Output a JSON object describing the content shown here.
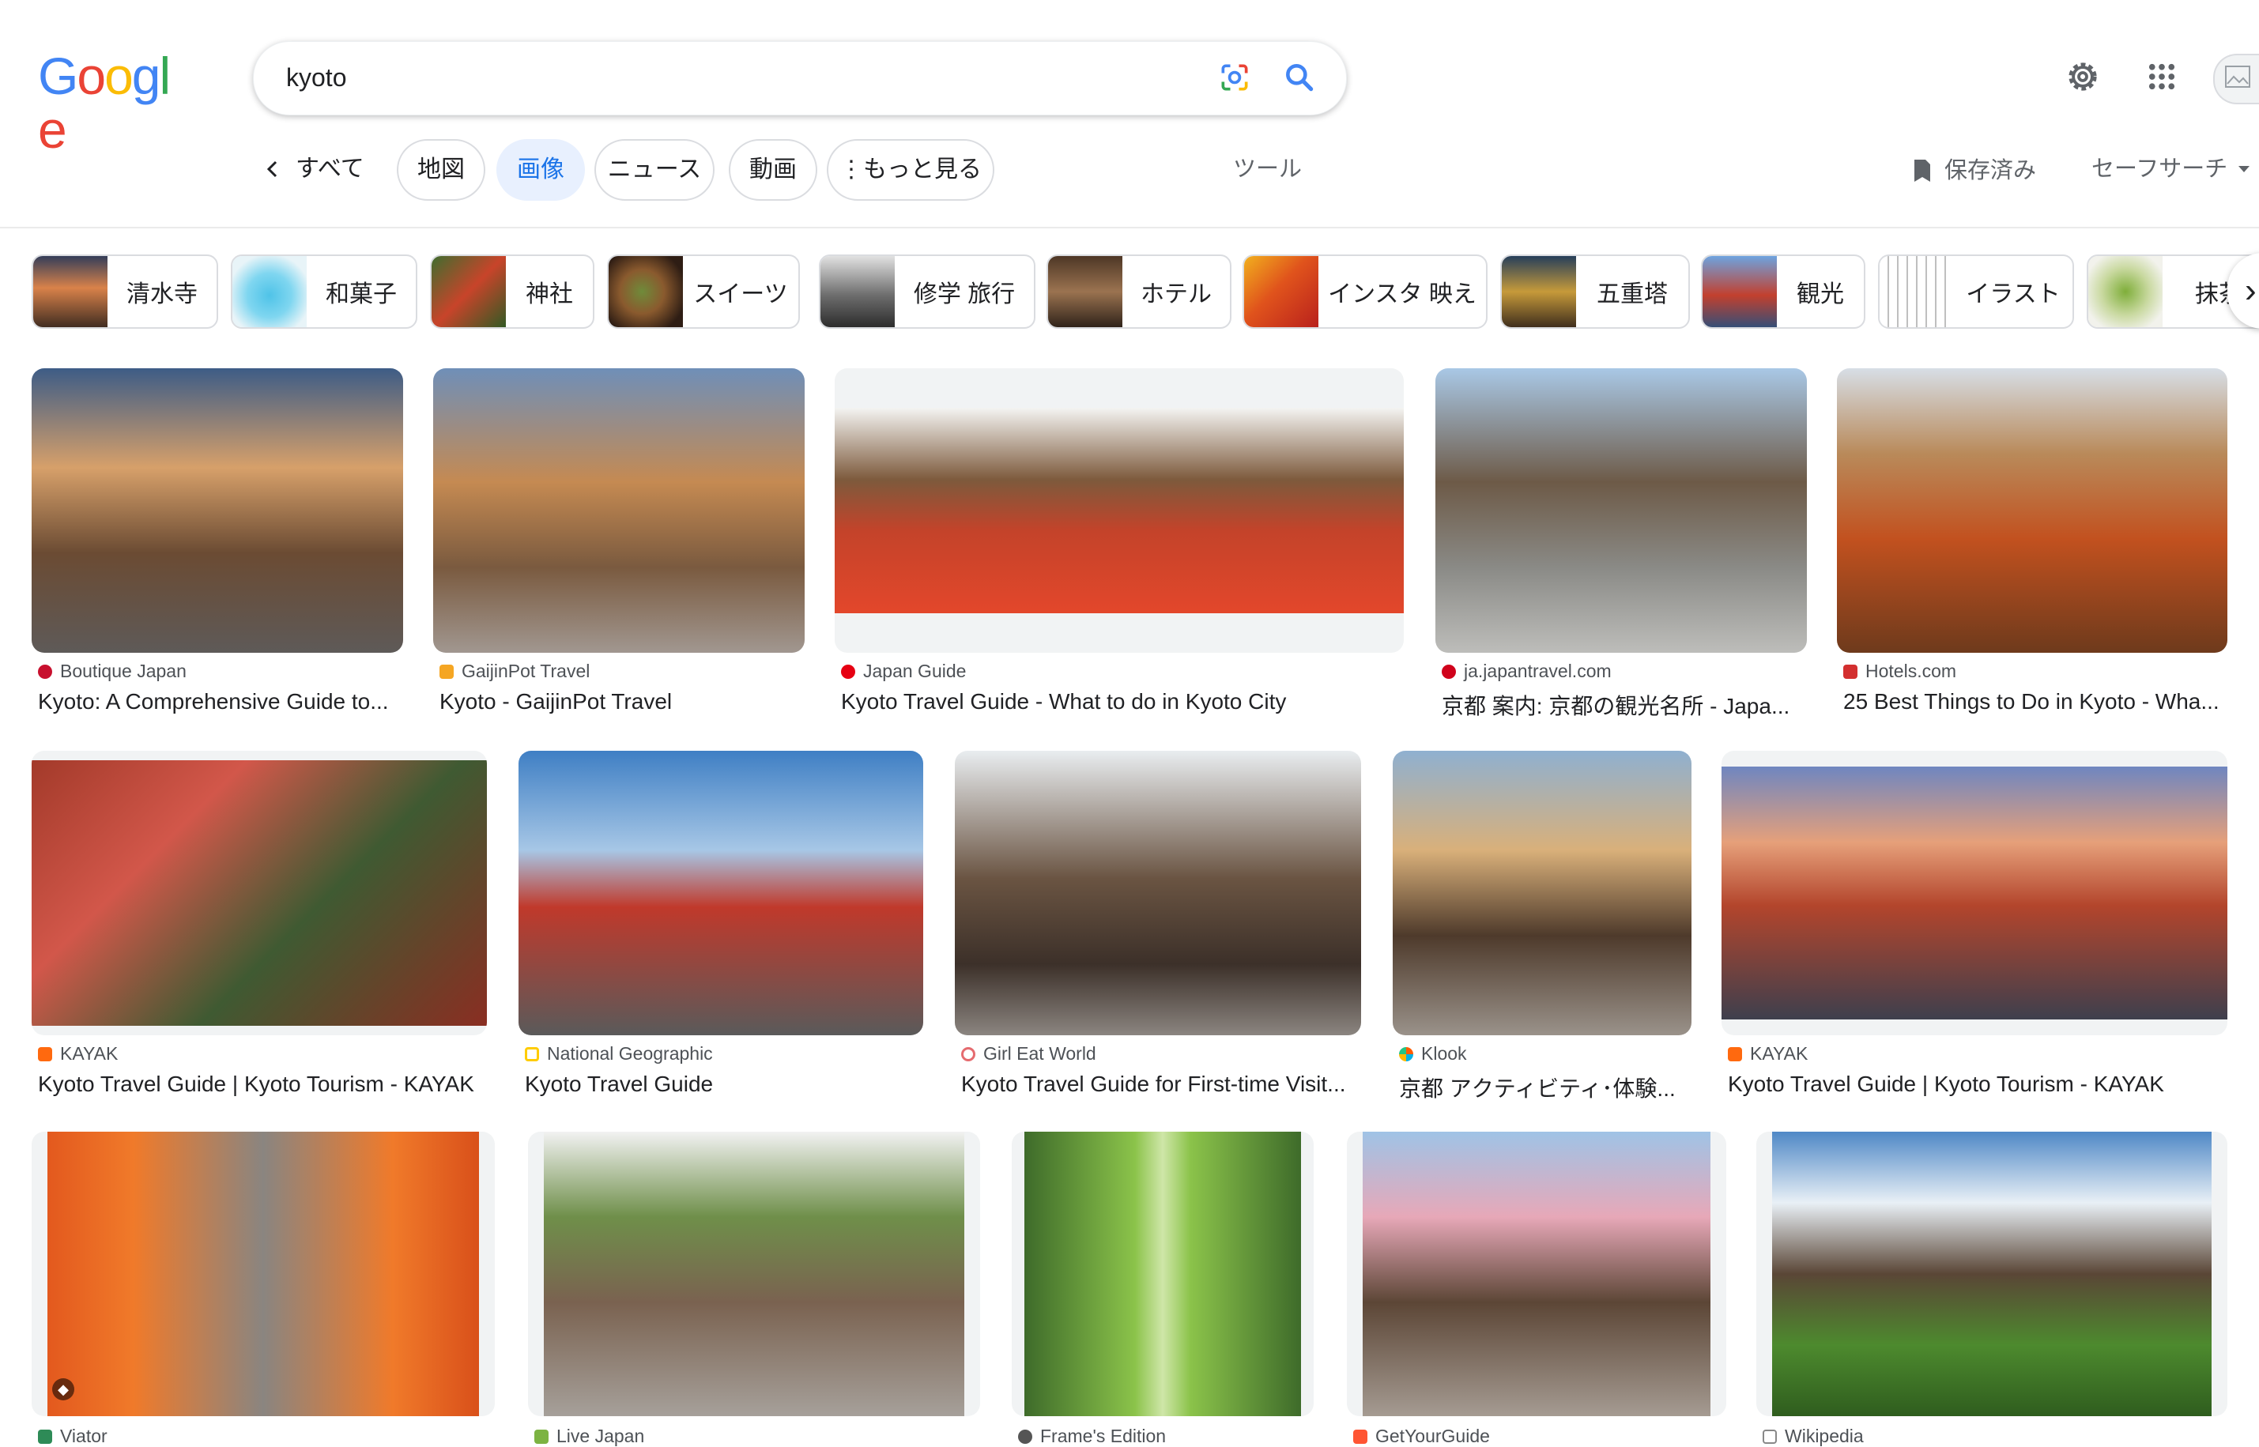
{
  "search": {
    "query": "kyoto"
  },
  "logo": {
    "letters": [
      "G",
      "o",
      "o",
      "g",
      "l",
      "e"
    ],
    "colors": [
      "#4285f4",
      "#ea4335",
      "#fbbc05",
      "#4285f4",
      "#34a853",
      "#ea4335"
    ]
  },
  "nav": {
    "back_label": "すべて",
    "tabs": [
      "地図",
      "画像",
      "ニュース",
      "動画",
      "もっと見る"
    ],
    "active_tab": "画像",
    "tools": "ツール",
    "saved": "保存済み",
    "safesearch": "セーフサーチ"
  },
  "icons": [
    "lens-icon",
    "magnifier-icon",
    "settings-icon",
    "apps-icon",
    "chevron-left-icon",
    "bookmark-icon",
    "caret-down-icon",
    "chevron-right-icon",
    "tag-icon"
  ],
  "chips": [
    "清水寺",
    "和菓子",
    "神社",
    "スイーツ",
    "修学 旅行",
    "ホテル",
    "インスタ 映え",
    "五重塔",
    "観光",
    "イラスト",
    "抹茶"
  ],
  "results_row1": [
    {
      "source": "Boutique Japan",
      "title": "Kyoto: A Comprehensive Guide to..."
    },
    {
      "source": "GaijinPot Travel",
      "title": "Kyoto - GaijinPot Travel"
    },
    {
      "source": "Japan Guide",
      "title": "Kyoto Travel Guide - What to do in Kyoto City"
    },
    {
      "source": "ja.japantravel.com",
      "title": "京都 案内: 京都の観光名所 - Japa..."
    },
    {
      "source": "Hotels.com",
      "title": "25 Best Things to Do in Kyoto - Wha..."
    }
  ],
  "results_row2": [
    {
      "source": "KAYAK",
      "title": "Kyoto Travel Guide | Kyoto Tourism - KAYAK"
    },
    {
      "source": "National Geographic",
      "title": "Kyoto Travel Guide"
    },
    {
      "source": "Girl Eat World",
      "title": "Kyoto Travel Guide for First-time Visit..."
    },
    {
      "source": "Klook",
      "title": "京都 アクティビティ･体験..."
    },
    {
      "source": "KAYAK",
      "title": "Kyoto Travel Guide | Kyoto Tourism - KAYAK"
    }
  ],
  "results_row3_partial_sources": [
    "Viator",
    "Live Japan",
    "Frame's Edition",
    "GetYourGuide",
    "Wikipedia"
  ],
  "colors": {
    "accent": "#1a73e8",
    "active_tab_bg": "#e8f0fe",
    "border": "#dadce0",
    "source_text": "#4d5156"
  }
}
